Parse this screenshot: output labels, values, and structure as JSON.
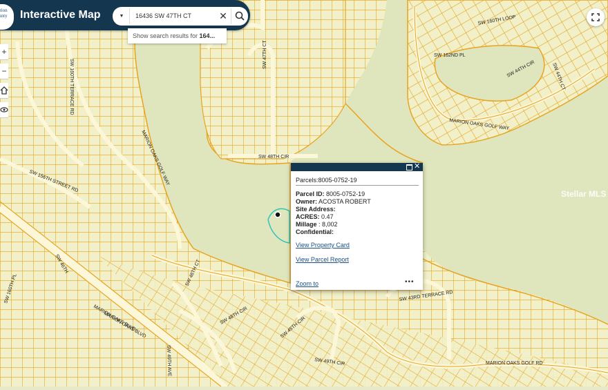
{
  "header": {
    "logo_lines": [
      "Marion",
      "County"
    ],
    "title": "Interactive Map"
  },
  "search": {
    "value": "16436 SW 47TH CT",
    "suggestion_prefix": "Show search results for ",
    "suggestion_term": "164..."
  },
  "icons": {
    "zoom_in": "plus-icon",
    "zoom_out": "minus-icon",
    "home": "home-icon",
    "layers": "eye-icon",
    "fullscreen": "fullscreen-icon",
    "search": "search-icon",
    "clear": "close-icon",
    "menu": "caret-down-icon"
  },
  "map": {
    "accent_color": "#e8a31f",
    "street_labels": [
      "SW 160TH LOOP",
      "SW 162ND PL",
      "SW 44TH CIR",
      "SW 44TH CT",
      "MARION OAKS GOLF WAY",
      "SW 47TH CT",
      "SW 48TH CIR",
      "MARION OAKS GOLF WAY",
      "SW 160TH TERRACE RD",
      "SW 156TH STREET RD",
      "SW 160TH PL",
      "MARION OAKS BLVD",
      "MARION OAKS BLVD",
      "SW 49TH AVE",
      "SW 48TH CT",
      "SW 48TH CIR",
      "SW 45TH CIR",
      "SW 43RD TERRACE RD",
      "MARION OAKS GOLF RD",
      "SW 49TH CIR",
      "SW 46TH"
    ],
    "watermark": "Stellar MLS"
  },
  "popup": {
    "title": "Parcels:8005-0752-19",
    "fields": [
      {
        "label": "Parcel ID:",
        "value": " 8005-0752-19"
      },
      {
        "label": "Owner:",
        "value": " ACOSTA ROBERT"
      },
      {
        "label": "Site Address:",
        "value": ""
      },
      {
        "label": "ACRES:",
        "value": " 0.47"
      },
      {
        "label": "Millage",
        "value": " : 8,002"
      },
      {
        "label": "Confidential:",
        "value": ""
      }
    ],
    "link_property_card": "View Property Card",
    "link_parcel_report": "View Parcel Report",
    "zoom_to": "Zoom to",
    "more": "•••"
  }
}
